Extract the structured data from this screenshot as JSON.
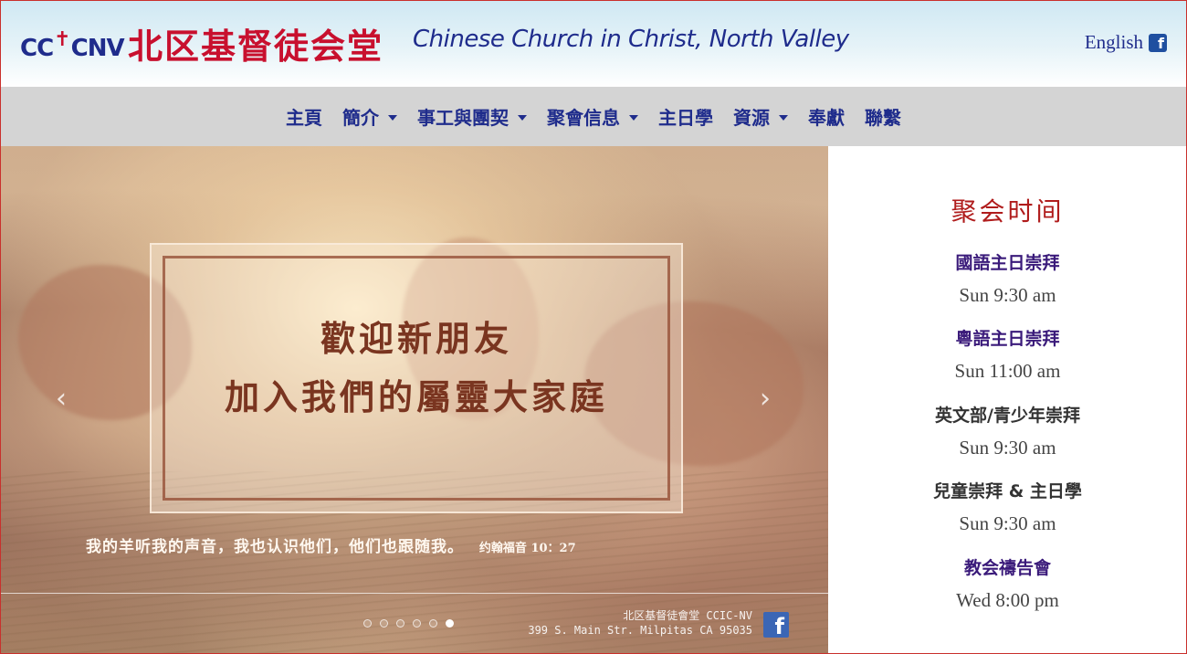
{
  "header": {
    "logo_mark_left": "CC",
    "logo_mark_cross": "✝",
    "logo_mark_right": "CNV",
    "chinese_name": "北区基督徒会堂",
    "english_name": "Chinese Church in Christ, North Valley",
    "language_link": "English",
    "facebook_icon": "f"
  },
  "nav": {
    "items": [
      {
        "label": "主頁",
        "has_dropdown": false
      },
      {
        "label": "簡介",
        "has_dropdown": true
      },
      {
        "label": "事工與團契",
        "has_dropdown": true
      },
      {
        "label": "聚會信息",
        "has_dropdown": true
      },
      {
        "label": "主日學",
        "has_dropdown": false
      },
      {
        "label": "資源",
        "has_dropdown": true
      },
      {
        "label": "奉獻",
        "has_dropdown": false
      },
      {
        "label": "聯繫",
        "has_dropdown": false
      }
    ]
  },
  "carousel": {
    "welcome_line1": "歡迎新朋友",
    "welcome_line2": "加入我們的屬靈大家庭",
    "verse_text": "我的羊听我的声音，我也认识他们，他们也跟随我。",
    "verse_reference": "约翰福音 10：27",
    "prev_arrow": "‹",
    "next_arrow": "›",
    "indicator_count": 6,
    "active_indicator": 6,
    "footer_line1": "北区基督徒會堂  CCIC-NV",
    "footer_line2": "399 S. Main Str. Milpitas CA 95035",
    "facebook_icon": "f"
  },
  "schedule": {
    "title": "聚会时间",
    "services": [
      {
        "name": "國語主日崇拜",
        "time": "Sun 9:30 am"
      },
      {
        "name": "粵語主日崇拜",
        "time": "Sun 11:00 am"
      },
      {
        "name": "英文部/青少年崇拜",
        "time": "Sun 9:30 am"
      },
      {
        "name": "兒童崇拜 & 主日學",
        "time": "Sun 9:30 am"
      },
      {
        "name": "教会禱告會",
        "time": "Wed 8:00 pm"
      }
    ]
  },
  "colors": {
    "brand_blue": "#1f2c8c",
    "brand_red": "#c8102e",
    "nav_bg": "#d4d4d4",
    "schedule_title_red": "#b01c1c",
    "service_purple": "#3a1a7a"
  }
}
